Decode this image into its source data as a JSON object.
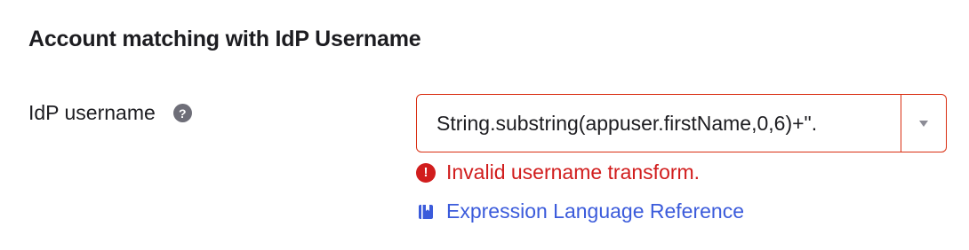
{
  "section": {
    "title": "Account matching with IdP Username"
  },
  "field": {
    "label": "IdP username",
    "help_icon": "question-circle-icon",
    "help_glyph": "?",
    "value": "String.substring(appuser.firstName,0,6)+\".",
    "toggle_icon": "caret-down-icon"
  },
  "error": {
    "icon": "error-circle-icon",
    "glyph": "!",
    "message": "Invalid username transform."
  },
  "link": {
    "icon": "book-icon",
    "label": "Expression Language Reference"
  },
  "colors": {
    "error": "#d11d1d",
    "link": "#3b5bdb",
    "border_error": "#d92e12",
    "help_icon_bg": "#6e6e78"
  }
}
